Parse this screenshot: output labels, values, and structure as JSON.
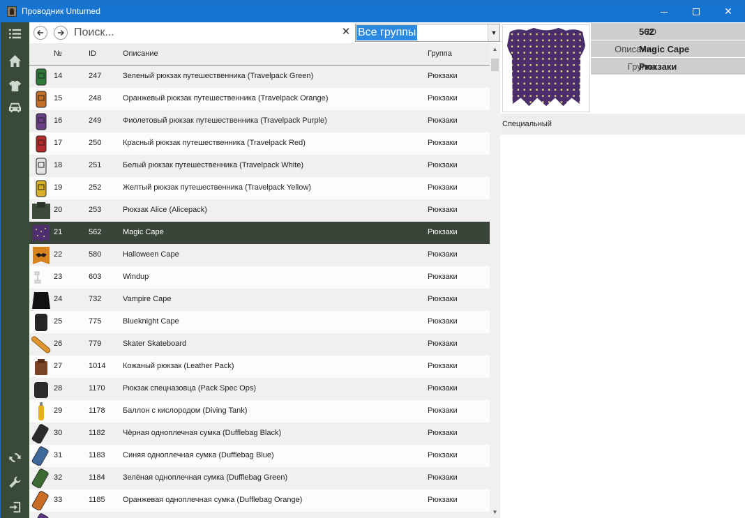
{
  "window": {
    "title": "Проводник Unturned"
  },
  "sidebar": {
    "icons": [
      "list-icon",
      "home-icon",
      "shirt-icon",
      "car-icon",
      "refresh-icon",
      "wrench-icon",
      "exit-icon"
    ]
  },
  "toolbar": {
    "search_placeholder": "Поиск...",
    "clear_glyph": "✕",
    "group_value": "Все группы"
  },
  "table": {
    "headers": {
      "num": "№",
      "id": "ID",
      "desc": "Описание",
      "group": "Группа"
    },
    "selected_index": 7,
    "rows": [
      {
        "num": "14",
        "id": "247",
        "desc": "Зеленый рюкзак путешественника (Travelpack Green)",
        "group": "Рюкзаки",
        "icon": "travelpack-green-icon",
        "color": "#2f7a3a"
      },
      {
        "num": "15",
        "id": "248",
        "desc": "Оранжевый рюкзак путешественника (Travelpack Orange)",
        "group": "Рюкзаки",
        "icon": "travelpack-orange-icon",
        "color": "#c4702a"
      },
      {
        "num": "16",
        "id": "249",
        "desc": "Фиолетовый рюкзак путешественника (Travelpack Purple)",
        "group": "Рюкзаки",
        "icon": "travelpack-purple-icon",
        "color": "#6a3f84"
      },
      {
        "num": "17",
        "id": "250",
        "desc": "Красный рюкзак путешественника (Travelpack Red)",
        "group": "Рюкзаки",
        "icon": "travelpack-red-icon",
        "color": "#b52a2a"
      },
      {
        "num": "18",
        "id": "251",
        "desc": "Белый рюкзак путешественника (Travelpack White)",
        "group": "Рюкзаки",
        "icon": "travelpack-white-icon",
        "color": "#e4e4e4"
      },
      {
        "num": "19",
        "id": "252",
        "desc": "Желтый рюкзак путешественника (Travelpack Yellow)",
        "group": "Рюкзаки",
        "icon": "travelpack-yellow-icon",
        "color": "#d7b227"
      },
      {
        "num": "20",
        "id": "253",
        "desc": "Рюкзак Alice (Alicepack)",
        "group": "Рюкзаки",
        "icon": "alicepack-icon",
        "color": "#3d4a3b"
      },
      {
        "num": "21",
        "id": "562",
        "desc": "Magic Cape",
        "group": "Рюкзаки",
        "icon": "magic-cape-icon",
        "color": "#4d2f6d"
      },
      {
        "num": "22",
        "id": "580",
        "desc": "Halloween Cape",
        "group": "Рюкзаки",
        "icon": "halloween-cape-icon",
        "color": "#d8841e"
      },
      {
        "num": "23",
        "id": "603",
        "desc": "Windup",
        "group": "Рюкзаки",
        "icon": "windup-icon",
        "color": "#e8e8e8"
      },
      {
        "num": "24",
        "id": "732",
        "desc": "Vampire Cape",
        "group": "Рюкзаки",
        "icon": "vampire-cape-icon",
        "color": "#111111"
      },
      {
        "num": "25",
        "id": "775",
        "desc": "Blueknight Cape",
        "group": "Рюкзаки",
        "icon": "blueknight-cape-icon",
        "color": "#262626"
      },
      {
        "num": "26",
        "id": "779",
        "desc": "Skater Skateboard",
        "group": "Рюкзаки",
        "icon": "skateboard-icon",
        "color": "#e0962e"
      },
      {
        "num": "27",
        "id": "1014",
        "desc": "Кожаный рюкзак (Leather Pack)",
        "group": "Рюкзаки",
        "icon": "leather-pack-icon",
        "color": "#7a4326"
      },
      {
        "num": "28",
        "id": "1170",
        "desc": "Рюкзак спецназовца (Pack Spec Ops)",
        "group": "Рюкзаки",
        "icon": "pack-spec-ops-icon",
        "color": "#2a2a2a"
      },
      {
        "num": "29",
        "id": "1178",
        "desc": "Баллон с кислородом (Diving Tank)",
        "group": "Рюкзаки",
        "icon": "diving-tank-icon",
        "color": "#e8b018"
      },
      {
        "num": "30",
        "id": "1182",
        "desc": "Чёрная одноплечная сумка (Dufflebag Black)",
        "group": "Рюкзаки",
        "icon": "dufflebag-black-icon",
        "color": "#2b2b2b"
      },
      {
        "num": "31",
        "id": "1183",
        "desc": "Синяя одноплечная сумка (Dufflebag Blue)",
        "group": "Рюкзаки",
        "icon": "dufflebag-blue-icon",
        "color": "#3d6a98"
      },
      {
        "num": "32",
        "id": "1184",
        "desc": "Зелёная одноплечная сумка (Dufflebag Green)",
        "group": "Рюкзаки",
        "icon": "dufflebag-green-icon",
        "color": "#3b6b33"
      },
      {
        "num": "33",
        "id": "1185",
        "desc": "Оранжевая одноплечная сумка (Dufflebag Orange)",
        "group": "Рюкзаки",
        "icon": "dufflebag-orange-icon",
        "color": "#c96d25"
      },
      {
        "num": "",
        "id": "",
        "desc": "",
        "group": "",
        "icon": "dufflebag-purple-icon",
        "color": "#5a3580"
      }
    ]
  },
  "detail": {
    "preview_icon": "magic-cape-icon",
    "id_label": "ID",
    "id_value": "562",
    "desc_label": "Описание",
    "desc_value": "Magic Cape",
    "group_label": "Группа",
    "group_value": "Рюкзаки",
    "special_label": "Специальный"
  }
}
